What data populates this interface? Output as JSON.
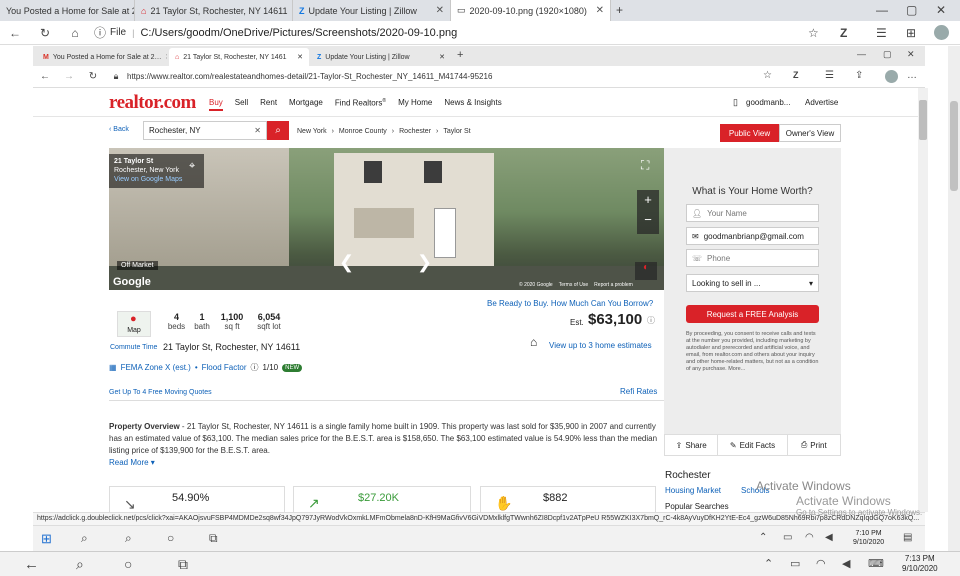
{
  "outer_browser": {
    "tabs": [
      {
        "label": "You Posted a Home for Sale at 2…",
        "active": false
      },
      {
        "label": "21 Taylor St, Rochester, NY 14611",
        "active": false
      },
      {
        "label": "Update Your Listing | Zillow",
        "active": false
      },
      {
        "label": "2020-09-10.png (1920×1080)",
        "active": true
      }
    ],
    "address": "C:/Users/goodm/OneDrive/Pictures/Screenshots/2020-09-10.png",
    "file_label": "File"
  },
  "inner_browser": {
    "tabs": [
      {
        "label": "You Posted a Home for Sale at 2…",
        "active": false
      },
      {
        "label": "21 Taylor St, Rochester, NY 1461",
        "active": true
      },
      {
        "label": "Update Your Listing | Zillow",
        "active": false
      }
    ],
    "address": "https://www.realtor.com/realestateandhomes-detail/21-Taylor-St_Rochester_NY_14611_M41744-95216",
    "status_url": "https://adclick.g.doubleclick.net/pcs/click?xai=AKAOjsvuFSBP4MDMDe2sq8wf34JpQ797JyRWodVkOxmkLMFmObmela8nD-KfH9MaGfivV6GiVDMxlklfgTWwnh6ZI8Dcpf1v2ATpPeU R55WZKI3X7bmQ_rC-4k8AyVuyDfKH2YtE-Ec4_gzW6uD85Nh69Rbi7p8zCRdDNZqIqdGQ7oK63kQ..."
  },
  "realtor": {
    "logo": "realtor.com",
    "nav": [
      "Buy",
      "Sell",
      "Rent",
      "Mortgage",
      "Find Realtors",
      "My Home",
      "News & Insights"
    ],
    "nav_sup": "®",
    "user": "goodmanb...",
    "advertise": "Advertise",
    "back": "Back",
    "search_value": "Rochester, NY",
    "breadcrumbs": [
      "New York",
      "Monroe County",
      "Rochester",
      "Taylor St"
    ],
    "public_view": "Public View",
    "owners_view": "Owner's View",
    "photo": {
      "street": "21 Taylor St",
      "city": "Rochester, New York",
      "maps_link": "View on Google Maps",
      "status": "Off Market",
      "google": "Google",
      "copyright": "© 2020 Google",
      "terms": "Terms of Use",
      "report": "Report a problem"
    },
    "borrow_link": "Be Ready to Buy. How Much Can You Borrow?",
    "map_label": "Map",
    "stats": [
      {
        "num": "4",
        "label": "beds"
      },
      {
        "num": "1",
        "label": "bath"
      },
      {
        "num": "1,100",
        "label": "sq ft"
      },
      {
        "num": "6,054",
        "label": "sqft lot"
      }
    ],
    "est_label": "Est.",
    "price": "$63,100",
    "commute": "Commute Time",
    "address": "21 Taylor St, Rochester, NY 14611",
    "estimates_link": "View up to 3 home estimates",
    "fema": "FEMA Zone X (est.)",
    "flood_factor": "Flood Factor",
    "flood_score": "1/10",
    "new_badge": "NEW",
    "moving_quotes": "Get Up To 4 Free Moving Quotes",
    "refi_rates": "Refi Rates",
    "overview_title": "Property Overview",
    "overview_text": " - 21 Taylor St, Rochester, NY 14611 is a single family home built in 1909. This property was last sold for $35,900 in 2007 and currently has an estimated value of $63,100. The median sales price for the B.E.S.T. area is $158,650. The $63,100 estimated value is 54.90% less than the median listing price of $139,900 for the B.E.S.T. area.",
    "read_more": "Read More",
    "bottom_cards": [
      {
        "value": "54.90%",
        "color": "#222222"
      },
      {
        "value": "$27.20K",
        "color": "#3a9b3a"
      },
      {
        "value": "$882",
        "color": "#222222"
      }
    ],
    "form": {
      "title": "What is Your Home Worth?",
      "name_placeholder": "Your Name",
      "email_value": "goodmanbrianp@gmail.com",
      "phone_placeholder": "Phone",
      "select_value": "Looking to sell in ...",
      "cta": "Request a FREE Analysis",
      "disclaimer": "By proceeding, you consent to receive calls and texts at the number you provided, including marketing by autodialer and prerecorded and artificial voice, and email, from realtor.com and others about your inquiry and other home-related matters, but not as a condition of any purchase. More..."
    },
    "actions": [
      "Share",
      "Edit Facts",
      "Print"
    ],
    "side": {
      "city": "Rochester",
      "tabs": [
        "Housing Market",
        "Schools"
      ],
      "popular": "Popular Searches"
    }
  },
  "watermark": {
    "title": "Activate Windows",
    "subtitle": "Go to Settings to activate Windows."
  },
  "inner_taskbar": {
    "time": "7:10 PM",
    "date": "9/10/2020"
  },
  "outer_taskbar": {
    "time": "7:13 PM",
    "date": "9/10/2020"
  },
  "colors": {
    "brand": "#d92228",
    "link": "#0e61b8"
  }
}
